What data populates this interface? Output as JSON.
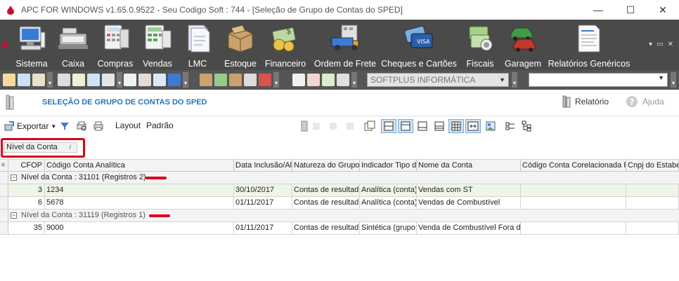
{
  "window": {
    "title": "APC FOR WINDOWS v1.65.0.9522 - Seu Codigo Soft : 744  - [Seleção de Grupo de Contas do SPED]",
    "minimize": "—",
    "maximize": "☐",
    "close": "✕"
  },
  "menu": {
    "items": [
      {
        "label": "Sistema",
        "icon": "computer-icon"
      },
      {
        "label": "Caixa",
        "icon": "cash-register-icon"
      },
      {
        "label": "Compras",
        "icon": "calculator-icon"
      },
      {
        "label": "Vendas",
        "icon": "sales-calculator-icon"
      },
      {
        "label": "LMC",
        "icon": "document-icon"
      },
      {
        "label": "Estoque",
        "icon": "box-icon"
      },
      {
        "label": "Financeiro",
        "icon": "money-icon"
      },
      {
        "label": "Ordem de Frete",
        "icon": "truck-icon"
      },
      {
        "label": "Cheques e Cartões",
        "icon": "cards-icon"
      },
      {
        "label": "Fiscais",
        "icon": "fiscal-icon"
      },
      {
        "label": "Garagem",
        "icon": "cars-icon"
      },
      {
        "label": "Relatórios Genéricos",
        "icon": "report-icon"
      }
    ],
    "mdi_controls": [
      "▾",
      "▭",
      "✕"
    ]
  },
  "quickbar": {
    "company": "SOFTPLUS INFORMÁTICA",
    "blank_value": ""
  },
  "page": {
    "title": "SELEÇÃO DE GRUPO DE CONTAS DO SPED",
    "report_label": "Relatório",
    "help_label": "Ajuda"
  },
  "toolbar": {
    "export_label": "Exportar",
    "layout_label": "Layout",
    "default_label": "Padrão"
  },
  "grid": {
    "group_by_chip": "Nível da Conta",
    "columns": [
      "CFOP",
      "Código Conta Analítica",
      "Data Inclusão/Al",
      "Natureza do Grupo",
      "Indicador Tipo d",
      "Nome da Conta",
      "Código Conta Corelacionada R",
      "Cnpj do Estabe"
    ],
    "groups": [
      {
        "label": "Nível da Conta : 31101 (Registros 2)",
        "rows": [
          {
            "cfop": "3",
            "codigo": "1234",
            "data": "30/10/2017",
            "natureza": "Contas de resultad",
            "indicador": "Analítica (conta)",
            "nome": "Vendas com ST",
            "corel": "",
            "cnpj": ""
          },
          {
            "cfop": "6",
            "codigo": "5678",
            "data": "01/11/2017",
            "natureza": "Contas de resultad",
            "indicador": "Analítica (conta)",
            "nome": "Vendas de Combustível",
            "corel": "",
            "cnpj": ""
          }
        ]
      },
      {
        "label": "Nível da Conta : 31119 (Registros 1)",
        "rows": [
          {
            "cfop": "35",
            "codigo": "9000",
            "data": "01/11/2017",
            "natureza": "Contas de resultad",
            "indicador": "Sintética (grupo",
            "nome": "Venda de Combustível Fora da",
            "corel": "",
            "cnpj": ""
          }
        ]
      }
    ]
  },
  "colors": {
    "accent": "#2a74b9",
    "highlight": "#d9001b",
    "toolbar_bg": "#4a4a4a"
  }
}
